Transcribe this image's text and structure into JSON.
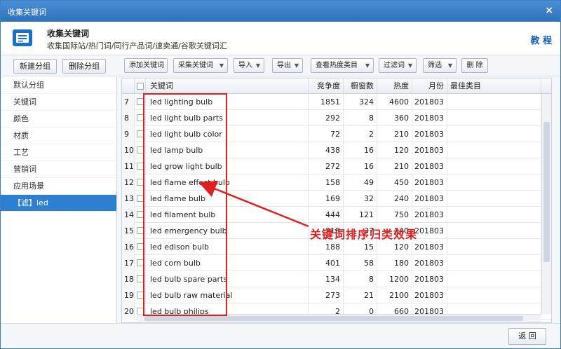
{
  "window": {
    "title": "收集关键词",
    "close_icon": "×"
  },
  "header": {
    "title": "收集关键词",
    "subtitle": "收集国际站/热门词/同行产品词/速卖通/谷歌关键词汇",
    "tutorial_link": "教 程"
  },
  "left": {
    "new_group": "新建分组",
    "delete_group": "删除分组",
    "groups": [
      "默认分组",
      "关键词",
      "颜色",
      "材质",
      "工艺",
      "营销词",
      "应用场景",
      "【滤】led"
    ],
    "selected_index": 7
  },
  "toolbar": {
    "add_keyword": "添加关键词",
    "collect_keyword": "采集关键词",
    "import": "导入",
    "export": "导出",
    "view_category": "查看热度类目",
    "filter_words": "过滤词",
    "screen": "筛选",
    "delete": "删 除"
  },
  "table": {
    "columns": [
      "",
      "",
      "关键词",
      "竞争度",
      "橱窗数",
      "热度",
      "月份",
      "最佳类目"
    ],
    "rows": [
      {
        "idx": "7",
        "keyword": "led lighting bulb",
        "competition": "1851",
        "showcase": "324",
        "heat": "4600",
        "month": "201803",
        "category": ""
      },
      {
        "idx": "8",
        "keyword": "led light bulb parts",
        "competition": "292",
        "showcase": "8",
        "heat": "360",
        "month": "201803",
        "category": ""
      },
      {
        "idx": "9",
        "keyword": "led light bulb color",
        "competition": "72",
        "showcase": "2",
        "heat": "210",
        "month": "201803",
        "category": ""
      },
      {
        "idx": "10",
        "keyword": "led lamp bulb",
        "competition": "438",
        "showcase": "16",
        "heat": "120",
        "month": "201803",
        "category": ""
      },
      {
        "idx": "11",
        "keyword": "led grow light bulb",
        "competition": "272",
        "showcase": "16",
        "heat": "210",
        "month": "201803",
        "category": ""
      },
      {
        "idx": "12",
        "keyword": "led flame effect bulb",
        "competition": "158",
        "showcase": "49",
        "heat": "450",
        "month": "201803",
        "category": ""
      },
      {
        "idx": "13",
        "keyword": "led flame bulb",
        "competition": "169",
        "showcase": "32",
        "heat": "240",
        "month": "201803",
        "category": ""
      },
      {
        "idx": "14",
        "keyword": "led filament bulb",
        "competition": "444",
        "showcase": "121",
        "heat": "750",
        "month": "201803",
        "category": ""
      },
      {
        "idx": "15",
        "keyword": "led emergency bulb",
        "competition": "218",
        "showcase": "37",
        "heat": "240",
        "month": "201803",
        "category": ""
      },
      {
        "idx": "16",
        "keyword": "led edison bulb",
        "competition": "188",
        "showcase": "15",
        "heat": "120",
        "month": "201803",
        "category": ""
      },
      {
        "idx": "17",
        "keyword": "led corn bulb",
        "competition": "401",
        "showcase": "58",
        "heat": "180",
        "month": "201803",
        "category": ""
      },
      {
        "idx": "18",
        "keyword": "led bulb spare parts",
        "competition": "134",
        "showcase": "8",
        "heat": "1200",
        "month": "201803",
        "category": ""
      },
      {
        "idx": "19",
        "keyword": "led bulb raw material",
        "competition": "273",
        "showcase": "21",
        "heat": "2100",
        "month": "201803",
        "category": ""
      },
      {
        "idx": "20",
        "keyword": "led bulb philips",
        "competition": "2",
        "showcase": "0",
        "heat": "660",
        "month": "201803",
        "category": ""
      }
    ]
  },
  "annotation": {
    "text": "关键词排序归类效果",
    "color": "#e02020"
  },
  "footer": {
    "back": "返 回"
  },
  "colors": {
    "titlebar": "#2f72bd",
    "selected": "#2f7fd0",
    "accent": "#e02020"
  }
}
